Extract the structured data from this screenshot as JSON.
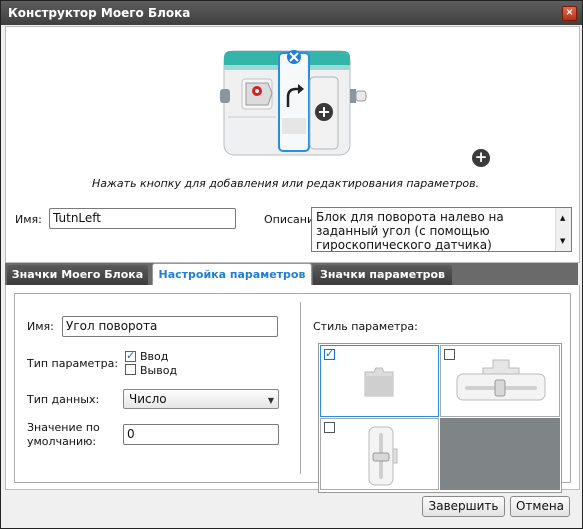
{
  "window": {
    "title": "Конструктор Моего Блока"
  },
  "top": {
    "hint": "Нажать кнопку для добавления или редактирования параметров.",
    "name_label": "Имя:",
    "name_value": "TutnLeft",
    "description_label": "Описание",
    "description_value": "Блок для поворота налево на заданный угол (с помощью гироскопического датчика)"
  },
  "tabs": [
    {
      "label": "Значки Моего Блока"
    },
    {
      "label": "Настройка параметров"
    },
    {
      "label": "Значки параметров"
    }
  ],
  "params": {
    "name_label": "Имя:",
    "name_value": "Угол поворота",
    "type_label": "Тип параметра:",
    "type_input_label": "Ввод",
    "type_output_label": "Вывод",
    "data_type_label": "Тип данных:",
    "data_type_value": "Число",
    "default_label": "Значение по умолчанию:",
    "default_value": "0",
    "style_label": "Стиль параметра:",
    "type_input_checked": true,
    "type_output_checked": false,
    "style_options_checked": [
      true,
      false,
      false
    ]
  },
  "buttons": {
    "finish": "Завершить",
    "cancel": "Отмена"
  },
  "colors": {
    "accent": "#1e7fd4",
    "block_teal": "#2fb0a6",
    "tab_dark": "#3c3c3c"
  }
}
